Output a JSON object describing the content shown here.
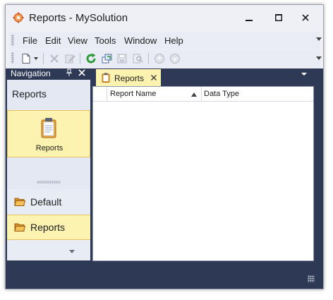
{
  "window": {
    "title": "Reports - MySolution",
    "icons": {
      "app": "gear-icon",
      "minimize": "minimize-icon",
      "maximize": "maximize-icon",
      "close": "close-icon"
    }
  },
  "menu": {
    "items": [
      "File",
      "Edit",
      "View",
      "Tools",
      "Window",
      "Help"
    ]
  },
  "toolbar": {
    "buttons": [
      {
        "name": "new-icon",
        "enabled": true
      },
      {
        "name": "new-dropdown-arrow-icon",
        "enabled": true
      },
      {
        "name": "delete-icon",
        "enabled": false
      },
      {
        "name": "edit-icon",
        "enabled": false
      },
      {
        "name": "refresh-icon",
        "enabled": true
      },
      {
        "name": "open-related-icon",
        "enabled": true
      },
      {
        "name": "save-icon",
        "enabled": false
      },
      {
        "name": "find-icon",
        "enabled": false
      },
      {
        "name": "previous-icon",
        "enabled": false
      },
      {
        "name": "next-icon",
        "enabled": false
      }
    ]
  },
  "navigation": {
    "header": "Navigation",
    "group_title": "Reports",
    "selected_item": "Reports",
    "groups": [
      {
        "label": "Default",
        "selected": false
      },
      {
        "label": "Reports",
        "selected": true
      }
    ]
  },
  "document": {
    "tab_label": "Reports",
    "columns": [
      "Report Name",
      "Data Type"
    ],
    "sorted_column": "Report Name",
    "sort_direction": "ascending",
    "rows": []
  },
  "colors": {
    "dock_background": "#2e3a55",
    "selection_fill": "#fdf3b0",
    "selection_border": "#e5c365",
    "chrome": "#eef0f6",
    "refresh_green": "#2e9b3a"
  }
}
